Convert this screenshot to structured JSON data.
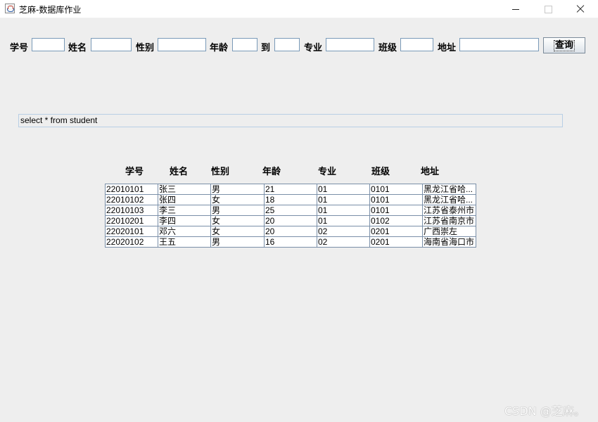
{
  "window": {
    "title": "芝麻-数据库作业"
  },
  "form": {
    "labels": {
      "id": "学号",
      "name": "姓名",
      "gender": "性别",
      "age": "年龄",
      "to": "到",
      "major": "专业",
      "class": "班级",
      "address": "地址"
    },
    "values": {
      "id": "",
      "name": "",
      "gender": "",
      "age_from": "",
      "age_to": "",
      "major": "",
      "class": "",
      "address": ""
    },
    "query_button": "查询"
  },
  "sql_text": "select * from student",
  "table": {
    "columns": [
      "学号",
      "姓名",
      "性别",
      "年龄",
      "专业",
      "班级",
      "地址"
    ],
    "rows": [
      [
        "22010101",
        "张三",
        "男",
        "21",
        "01",
        "0101",
        "黑龙江省哈..."
      ],
      [
        "22010102",
        "张四",
        "女",
        "18",
        "01",
        "0101",
        "黑龙江省哈..."
      ],
      [
        "22010103",
        "李三",
        "男",
        "25",
        "01",
        "0101",
        "江苏省泰州市"
      ],
      [
        "22010201",
        "李四",
        "女",
        "20",
        "01",
        "0102",
        "江苏省南京市"
      ],
      [
        "22020101",
        "邓六",
        "女",
        "20",
        "02",
        "0201",
        "广西崇左"
      ],
      [
        "22020102",
        "王五",
        "男",
        "16",
        "02",
        "0201",
        "海南省海口市"
      ]
    ]
  },
  "watermark": "CSDN @芝麻。"
}
